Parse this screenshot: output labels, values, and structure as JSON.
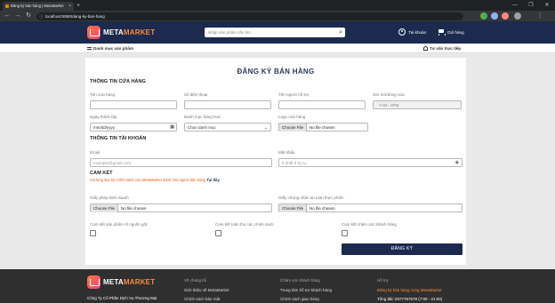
{
  "browser": {
    "tab_title": "Đăng ký bán hàng | MetaMarket",
    "url": "localhost:8080/dang-ky-ban-hang",
    "new_tab": "+",
    "win_min": "—",
    "win_max": "❐",
    "win_close": "✕",
    "tab_close": "×",
    "back": "←",
    "forward": "→",
    "reload": "↻",
    "lock": "ⓘ"
  },
  "header": {
    "logo_part1": "META",
    "logo_part2": "MARKET",
    "search_placeholder": "Nhập sản phẩm cần tìm ...",
    "search_icon": "⌕",
    "account_label": "Tài khoản",
    "cart_label": "Giỏ hàng"
  },
  "subnav": {
    "categories": "Danh mục sản phẩm",
    "support": "Tư vấn trực tiếp"
  },
  "form": {
    "title": "ĐĂNG KÝ BÁN HÀNG",
    "store_section": "THÔNG TIN CỬA HÀNG",
    "store_name_label": "Tên cửa hàng",
    "phone_label": "Số điện thoại",
    "owner_label": "Tên người hỗ trợ",
    "hours_label": "Giờ mở/đóng cửa",
    "hours_value": "7AM - 8PM",
    "founded_label": "Ngày thành lập",
    "founded_placeholder": "mm/dd/yyyy",
    "category_label": "Danh mục hàng hoá",
    "category_value": "Chọn danh mục",
    "logo_label": "Logo cửa hàng",
    "choose_file": "Choose File",
    "no_file": "No file chosen",
    "account_section": "THÔNG TIN TÀI KHOẢN",
    "email_label": "Email",
    "email_placeholder": "example@gmail.com",
    "password_label": "Mật khẩu",
    "password_placeholder": "Ít nhất 8 ký tự",
    "commit_section": "CAM KẾT",
    "commit_note": "Vui lòng đọc kỹ chính sách của MetaMarket dành cho người bán hàng",
    "commit_link": "Tại đây",
    "license_label": "Giấy phép kinh doanh",
    "safety_label": "Giấy chứng nhận an toàn thực phẩm",
    "origin_label": "Cam kết sản phẩm rõ nguồn gốc",
    "policy_label": "Cam kết tuân thủ các chính sách",
    "care_label": "Cam kết chăm sóc khách hàng",
    "submit_label": "ĐĂNG KÝ"
  },
  "footer": {
    "company": "Công Ty Cổ Phần Dịch Vụ Thương Mại",
    "col1_title": "Về chúng tôi",
    "col1_item1": "Giới thiệu về MetaMarket",
    "col1_item2": "Chính sách bảo mật",
    "col2_title": "Chăm sóc khách hàng",
    "col2_item1": "Trung tâm hỗ trợ khách hàng",
    "col2_item2": "Chính sách giao hàng",
    "col3_title": "Hỗ trợ",
    "col3_item1": "Đăng ký bán hàng cùng MetaMarket",
    "col3_item2": "Tổng đài: 0377757578 (7:00 - 21:00)"
  },
  "colors": {
    "brand_navy": "#1b2a4e",
    "brand_orange": "#ff8a3d",
    "footer_bg": "#2f2f2f"
  }
}
